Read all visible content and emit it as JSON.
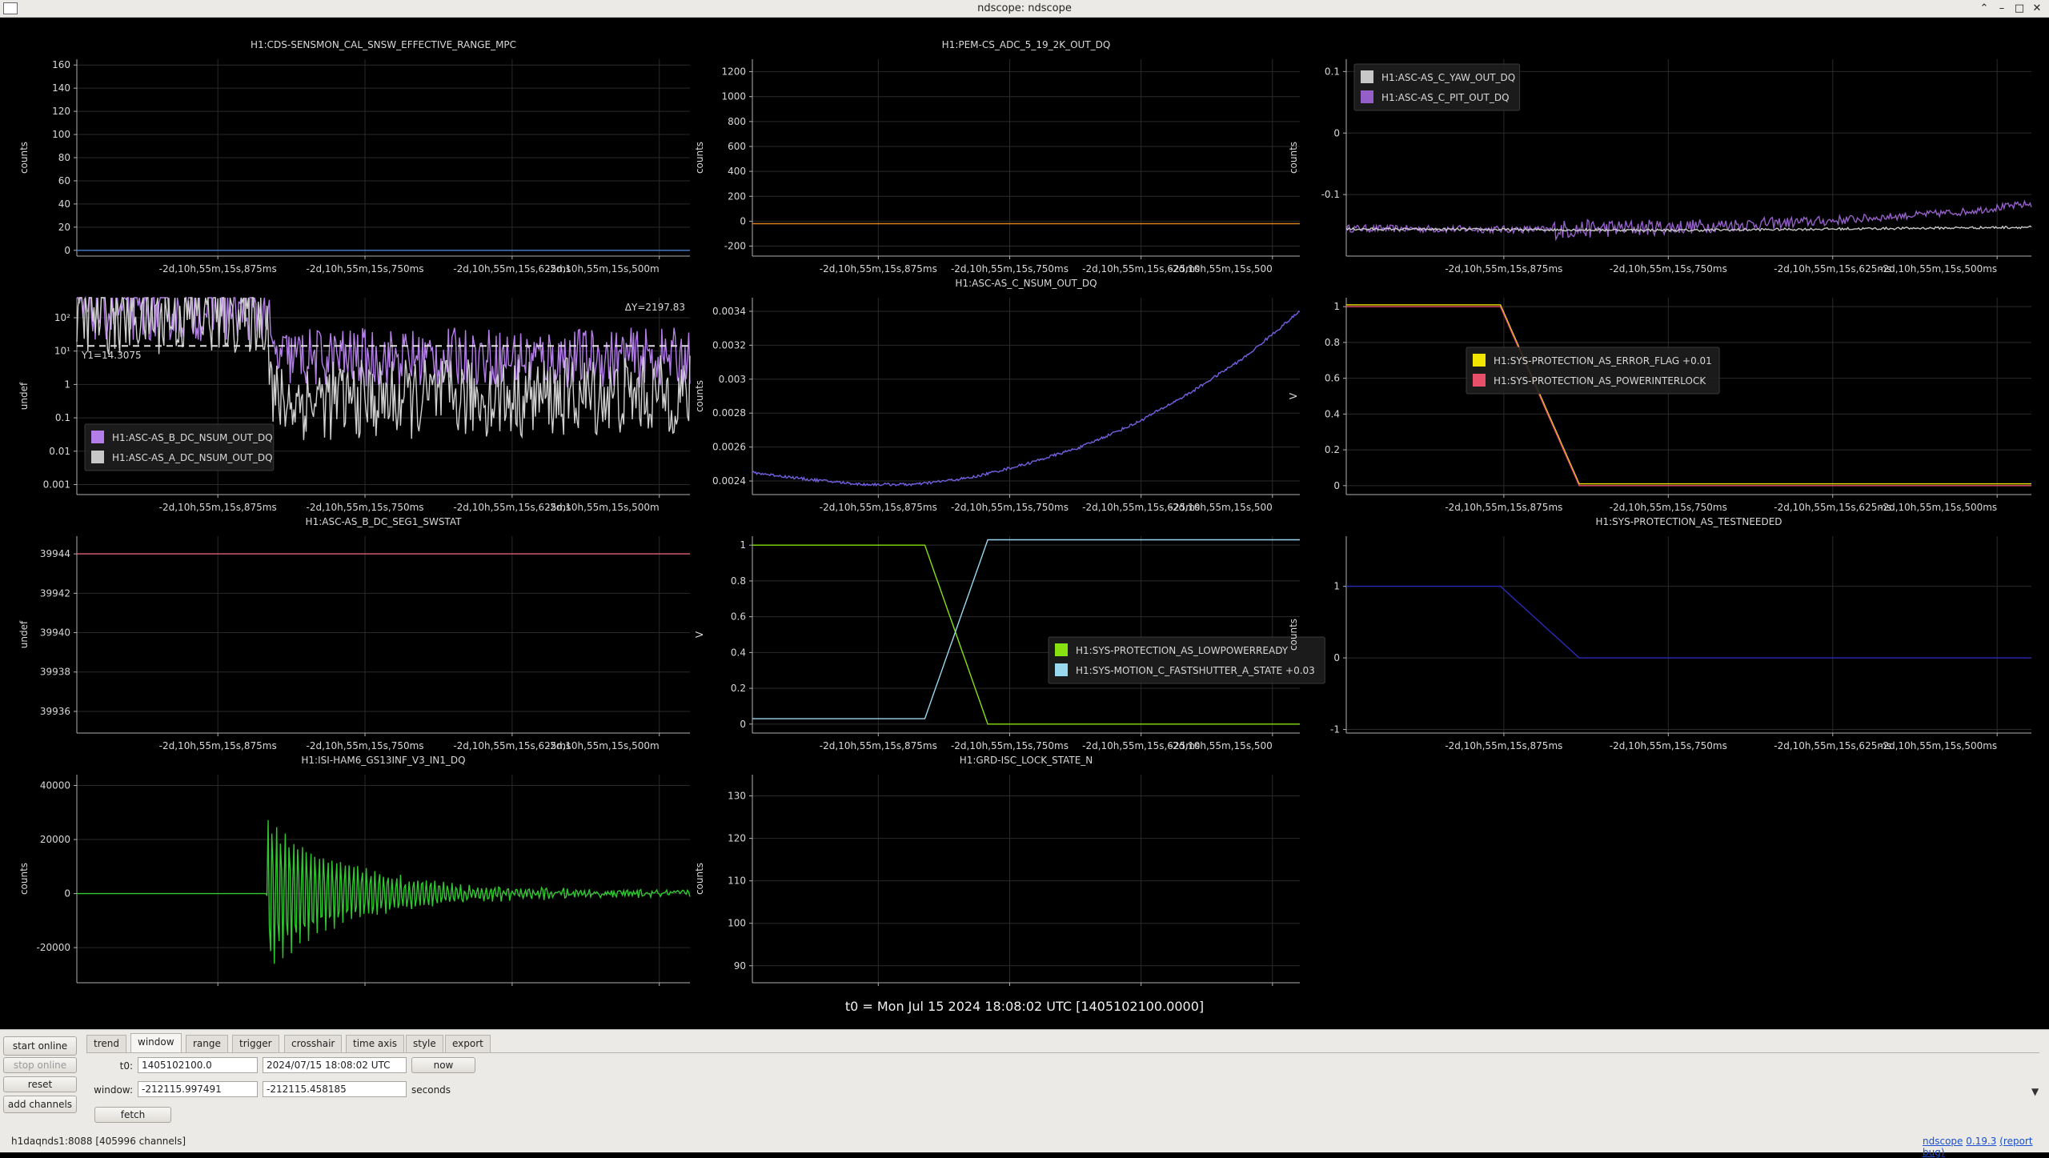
{
  "window": {
    "title": "ndscope: ndscope"
  },
  "colors": {
    "bg": "#000000",
    "grid": "#2a2a2a",
    "axis": "#b0b0b0",
    "text": "#d8d8d8"
  },
  "t0_label": "t0 = Mon Jul 15 2024 18:08:02 UTC [1405102100.0000]",
  "chart_data": [
    {
      "type": "line",
      "title": "H1:CDS-SENSMON_CAL_SNSW_EFFECTIVE_RANGE_MPC",
      "ylabel": "counts",
      "yticks": [
        "160",
        "140",
        "120",
        "100",
        "80",
        "60",
        "40",
        "20",
        "0"
      ],
      "xticks": [
        "-2d,10h,55m,15s,875ms",
        "-2d,10h,55m,15s,750ms",
        "-2d,10h,55m,15s,625ms",
        "-2d,10h,55m,15s,500m"
      ],
      "ylim": [
        -5,
        165
      ],
      "series": [
        {
          "color": "#4a7fd0",
          "x": [
            0,
            1
          ],
          "y": [
            0,
            0
          ]
        }
      ]
    },
    {
      "type": "line",
      "title": "H1:PEM-CS_ADC_5_19_2K_OUT_DQ",
      "ylabel": "counts",
      "yticks": [
        "1200",
        "1000",
        "800",
        "600",
        "400",
        "200",
        "0",
        "-200"
      ],
      "xticks": [
        "-2d,10h,55m,15s,875ms",
        "-2d,10h,55m,15s,750ms",
        "-2d,10h,55m,15s,625ms",
        "-2d,10h,55m,15s,500"
      ],
      "ylim": [
        -280,
        1300
      ],
      "series": [
        {
          "color": "#d8801c",
          "x": [
            0,
            1
          ],
          "y": [
            -20,
            -20
          ]
        }
      ]
    },
    {
      "type": "line",
      "title": "",
      "ylabel": "counts",
      "yticks": [
        "0.1",
        "0",
        "-0.1"
      ],
      "xticks": [
        "-2d,10h,55m,15s,875ms",
        "-2d,10h,55m,15s,750ms",
        "-2d,10h,55m,15s,625ms",
        "-2d,10h,55m,15s,500ms"
      ],
      "ylim": [
        -0.2,
        0.12
      ],
      "legend": [
        {
          "name": "H1:ASC-AS_C_YAW_OUT_DQ",
          "color": "#c8c8c8"
        },
        {
          "name": "H1:ASC-AS_C_PIT_OUT_DQ",
          "color": "#9460c8"
        }
      ],
      "series": [
        {
          "name": "H1:ASC-AS_C_PIT_OUT_DQ",
          "color": "#9460c8",
          "x": [
            0,
            0.3,
            0.5,
            0.7,
            0.9,
            1
          ],
          "y": [
            -0.155,
            -0.157,
            -0.152,
            -0.143,
            -0.128,
            -0.115
          ],
          "noise": 0.006,
          "burst": [
            0.3,
            0.01
          ]
        },
        {
          "name": "H1:ASC-AS_C_YAW_OUT_DQ",
          "color": "#c8c8c8",
          "x": [
            0,
            0.5,
            1
          ],
          "y": [
            -0.156,
            -0.158,
            -0.153
          ],
          "noise": 0.002
        }
      ]
    },
    {
      "type": "line",
      "title": "",
      "ylabel": "undef",
      "scale": "log",
      "yticks": [
        "10²",
        "10¹",
        "1",
        "0.1",
        "0.01",
        "0.001"
      ],
      "xticks": [
        "-2d,10h,55m,15s,875ms",
        "-2d,10h,55m,15s,750ms",
        "-2d,10h,55m,15s,625ms",
        "-2d,10h,55m,15s,500m"
      ],
      "ylim": [
        -3.3,
        2.6
      ],
      "annotations": [
        "ΔY=2197.83",
        "Y1=14.3075"
      ],
      "cursor_y": 14.3075,
      "legend": [
        {
          "name": "H1:ASC-AS_B_DC_NSUM_OUT_DQ",
          "color": "#b47ee8"
        },
        {
          "name": "H1:ASC-AS_A_DC_NSUM_OUT_DQ",
          "color": "#c8c8c8"
        }
      ],
      "series": [
        {
          "name": "H1:ASC-AS_B_DC_NSUM_OUT_DQ",
          "color": "#b47ee8",
          "x": [
            0,
            0.31,
            0.32,
            1
          ],
          "y": [
            2.2,
            2.2,
            0.8,
            0.8
          ],
          "noise": 0.9
        },
        {
          "name": "H1:ASC-AS_A_DC_NSUM_OUT_DQ",
          "color": "#d0d0d0",
          "x": [
            0,
            0.31,
            0.32,
            1
          ],
          "y": [
            2.1,
            2.1,
            -0.5,
            -0.3
          ],
          "noise": 1.2
        }
      ]
    },
    {
      "type": "line",
      "title": "H1:ASC-AS_C_NSUM_OUT_DQ",
      "ylabel": "counts",
      "yticks": [
        "0.0034",
        "0.0032",
        "0.003",
        "0.0028",
        "0.0026",
        "0.0024"
      ],
      "xticks": [
        "-2d,10h,55m,15s,875ms",
        "-2d,10h,55m,15s,750ms",
        "-2d,10h,55m,15s,625ms",
        "-2d,10h,55m,15s,500"
      ],
      "ylim": [
        0.00232,
        0.00348
      ],
      "series": [
        {
          "color": "#7060e0",
          "x": [
            0,
            0.1,
            0.2,
            0.3,
            0.4,
            0.5,
            0.6,
            0.7,
            0.8,
            0.9,
            1
          ],
          "y": [
            0.00245,
            0.00241,
            0.00238,
            0.00238,
            0.00242,
            0.0025,
            0.0026,
            0.00274,
            0.00292,
            0.00313,
            0.0034
          ],
          "noise": 8e-06
        }
      ]
    },
    {
      "type": "line",
      "title": "",
      "ylabel": "V",
      "yticks": [
        "1",
        "0.8",
        "0.6",
        "0.4",
        "0.2",
        "0"
      ],
      "xticks": [
        "-2d,10h,55m,15s,875ms",
        "-2d,10h,55m,15s,750ms",
        "-2d,10h,55m,15s,625ms",
        "-2d,10h,55m,15s,500ms"
      ],
      "ylim": [
        -0.05,
        1.05
      ],
      "legend": [
        {
          "name": "H1:SYS-PROTECTION_AS_ERROR_FLAG +0.01",
          "color": "#f2e600"
        },
        {
          "name": "H1:SYS-PROTECTION_AS_POWERINTERLOCK",
          "color": "#e8506a"
        }
      ],
      "series": [
        {
          "name": "H1:SYS-PROTECTION_AS_ERROR_FLAG +0.01",
          "color": "#f2e600",
          "x": [
            0,
            0.225,
            0.34,
            1
          ],
          "y": [
            1.01,
            1.01,
            0.01,
            0.01
          ]
        },
        {
          "name": "H1:SYS-PROTECTION_AS_POWERINTERLOCK",
          "color": "#e8506a",
          "x": [
            0,
            0.225,
            0.34,
            1
          ],
          "y": [
            1,
            1,
            0,
            0
          ]
        }
      ]
    },
    {
      "type": "line",
      "title": "H1:ASC-AS_B_DC_SEG1_SWSTAT",
      "ylabel": "undef",
      "yticks": [
        "39944",
        "39942",
        "39940",
        "39938",
        "39936"
      ],
      "xticks": [
        "-2d,10h,55m,15s,875ms",
        "-2d,10h,55m,15s,750ms",
        "-2d,10h,55m,15s,625ms",
        "-2d,10h,55m,15s,500m"
      ],
      "ylim": [
        39934.9,
        39944.9
      ],
      "series": [
        {
          "color": "#e06070",
          "x": [
            0,
            1
          ],
          "y": [
            39944,
            39944
          ]
        }
      ]
    },
    {
      "type": "line",
      "title": "",
      "ylabel": "V",
      "yticks": [
        "1",
        "0.8",
        "0.6",
        "0.4",
        "0.2",
        "0"
      ],
      "xticks": [
        "-2d,10h,55m,15s,875ms",
        "-2d,10h,55m,15s,750ms",
        "-2d,10h,55m,15s,625ms",
        "-2d,10h,55m,15s,500"
      ],
      "ylim": [
        -0.05,
        1.05
      ],
      "legend": [
        {
          "name": "H1:SYS-PROTECTION_AS_LOWPOWERREADY",
          "color": "#88e010"
        },
        {
          "name": "H1:SYS-MOTION_C_FASTSHUTTER_A_STATE +0.03",
          "color": "#9ad8f0"
        }
      ],
      "series": [
        {
          "name": "H1:SYS-PROTECTION_AS_LOWPOWERREADY",
          "color": "#88e010",
          "x": [
            0,
            0.315,
            0.43,
            1
          ],
          "y": [
            1,
            1,
            0,
            0
          ]
        },
        {
          "name": "H1:SYS-MOTION_C_FASTSHUTTER_A_STATE +0.03",
          "color": "#9ad8f0",
          "x": [
            0,
            0.315,
            0.43,
            1
          ],
          "y": [
            0.03,
            0.03,
            1.03,
            1.03
          ]
        }
      ]
    },
    {
      "type": "line",
      "title": "H1:SYS-PROTECTION_AS_TESTNEEDED",
      "ylabel": "counts",
      "yticks": [
        "1",
        "0",
        "-1"
      ],
      "xticks": [
        "-2d,10h,55m,15s,875ms",
        "-2d,10h,55m,15s,750ms",
        "-2d,10h,55m,15s,625ms",
        "-2d,10h,55m,15s,500ms"
      ],
      "ylim": [
        -1.05,
        1.7
      ],
      "series": [
        {
          "color": "#2a2ab8",
          "x": [
            0,
            0.225,
            0.34,
            1
          ],
          "y": [
            1,
            1,
            0,
            0
          ]
        }
      ]
    },
    {
      "type": "line",
      "title": "H1:ISI-HAM6_GS13INF_V3_IN1_DQ",
      "ylabel": "counts",
      "yticks": [
        "40000",
        "20000",
        "0",
        "-20000"
      ],
      "xticks": [
        "-2d,10h,55m,15s,875ms",
        "-2d,10h,55m,15s,750ms",
        "-2d,10h,55m,15s,625ms",
        "-2d,10h,55m,15s,500m"
      ],
      "ylim": [
        -33000,
        44000
      ],
      "series": [
        {
          "color": "#30c830",
          "x": [
            0,
            0.31,
            1
          ],
          "y": [
            0,
            0,
            0
          ],
          "ringdown": {
            "start": 0.31,
            "amp": 28000,
            "decay": 7
          }
        }
      ]
    },
    {
      "type": "line",
      "title": "H1:GRD-ISC_LOCK_STATE_N",
      "ylabel": "counts",
      "yticks": [
        "130",
        "120",
        "110",
        "100",
        "90"
      ],
      "xticks": [
        "-2d,10h,55m,15s,875ms",
        "-2d,10h,55m,15s,750ms",
        "-2d,10h,55m,15s,625ms",
        "-2d,10h,55m,15s,500"
      ],
      "ylim": [
        86,
        135
      ],
      "series": []
    }
  ],
  "controls": {
    "start_online": "start online",
    "stop_online": "stop online",
    "reset": "reset",
    "add_channels": "add channels",
    "tabs": [
      "trend",
      "window",
      "range",
      "trigger",
      "crosshair",
      "time axis",
      "style",
      "export"
    ],
    "active_tab": "window",
    "t0_label": "t0:",
    "t0_gps": "1405102100.0",
    "t0_utc": "2024/07/15 18:08:02 UTC",
    "now": "now",
    "window_label": "window:",
    "window_start": "-212115.997491",
    "window_end": "-212115.458185",
    "seconds": "seconds",
    "fetch": "fetch"
  },
  "status": {
    "server": "h1daqnds1:8088  [405996 channels]",
    "app": "ndscope",
    "version": "0.19.3",
    "report_bug": "(report bug)"
  }
}
